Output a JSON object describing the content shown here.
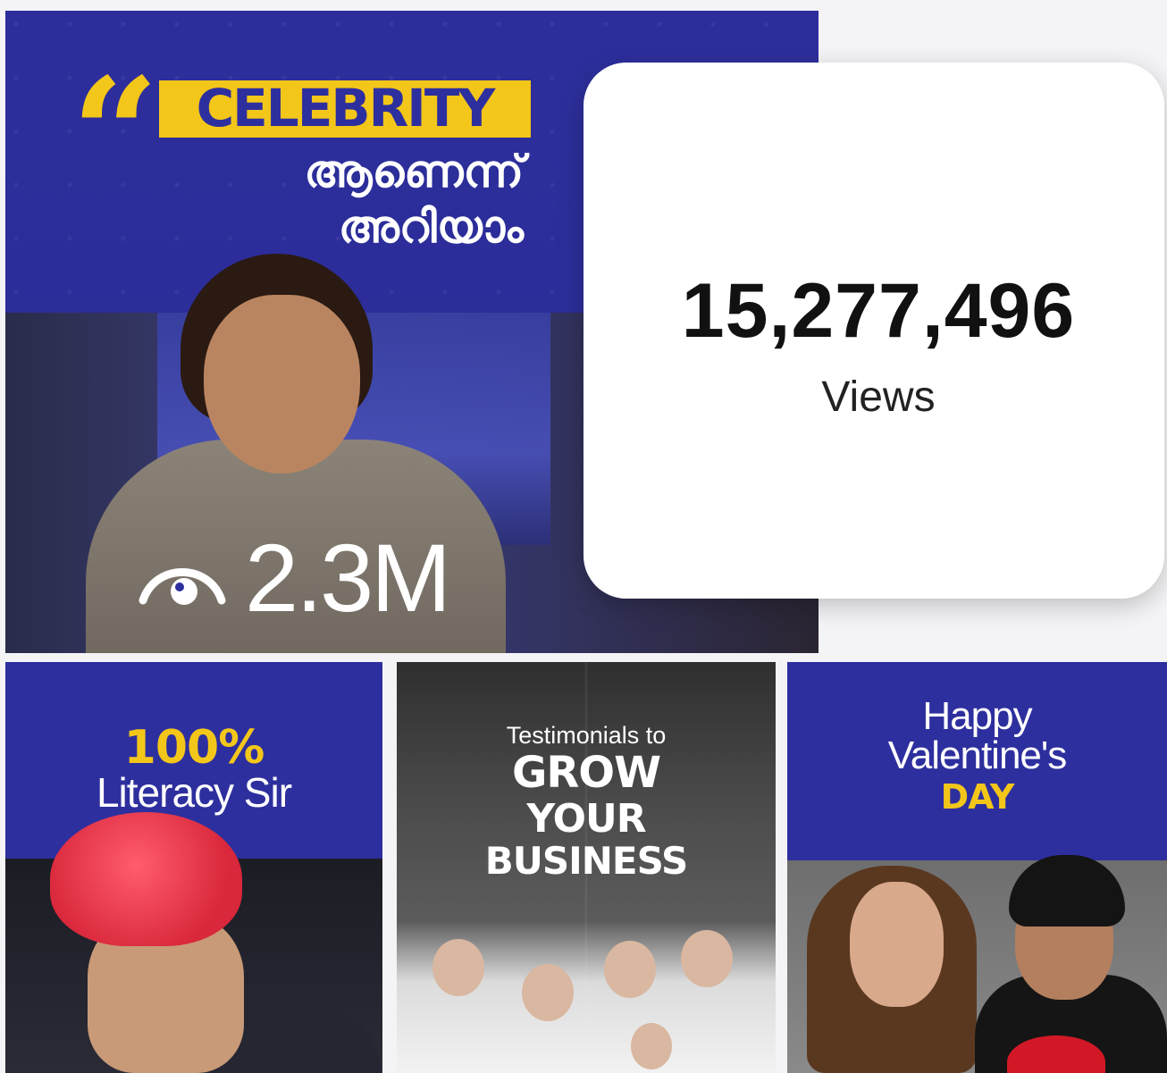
{
  "hero": {
    "quote_mark": "“",
    "title": "CELEBRITY",
    "malayalam_line_1": "ആണെന്ന്",
    "malayalam_line_2": "അറിയാം",
    "views": "2.3M",
    "views_icon": "eye-icon"
  },
  "stats": {
    "number": "15,277,496",
    "label": "Views"
  },
  "tiles": {
    "literacy": {
      "headline": "100%",
      "subtitle": "Literacy Sir"
    },
    "testimonials": {
      "intro": "Testimonials to",
      "line_1": "GROW",
      "line_2": "YOUR",
      "line_3": "BUSINESS"
    },
    "valentine": {
      "line_1": "Happy",
      "line_2": "Valentine's",
      "line_3": "DAY"
    }
  },
  "colors": {
    "brand_blue": "#2e2f9e",
    "accent_yellow": "#f3c61a",
    "card_white": "#ffffff"
  }
}
